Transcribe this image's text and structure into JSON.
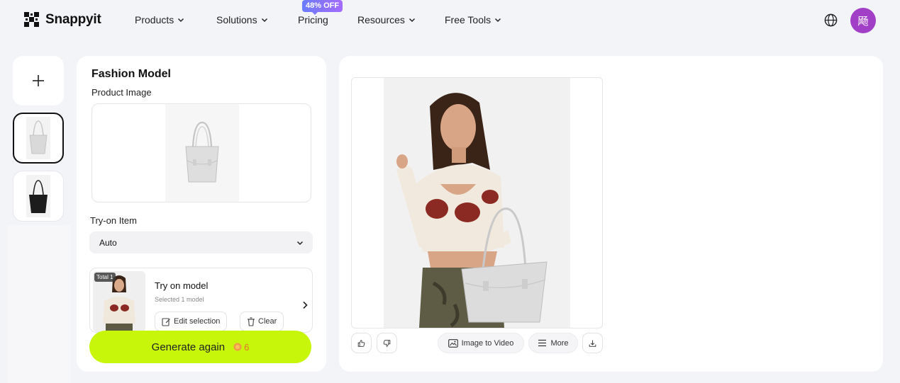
{
  "header": {
    "brand": "Snappyit",
    "nav": [
      {
        "label": "Products",
        "has_dropdown": true
      },
      {
        "label": "Solutions",
        "has_dropdown": true
      },
      {
        "label": "Pricing",
        "has_dropdown": false
      },
      {
        "label": "Resources",
        "has_dropdown": true
      },
      {
        "label": "Free Tools",
        "has_dropdown": true
      }
    ],
    "promo_badge": "48% OFF",
    "globe_icon": "globe-icon",
    "avatar_initial": "飏",
    "avatar_color": "#a13fc7"
  },
  "history": {
    "new_icon": "plus-icon",
    "items": [
      {
        "kind": "white-handbag",
        "selected": true
      },
      {
        "kind": "black-handbag",
        "selected": false
      }
    ]
  },
  "settings": {
    "title": "Fashion Model",
    "product_image_label": "Product Image",
    "tryon_label": "Try-on Item",
    "tryon_value": "Auto",
    "model_card": {
      "badge": "Total 1",
      "title": "Try on model",
      "subtitle": "Selected 1 model",
      "edit_label": "Edit selection",
      "clear_label": "Clear"
    },
    "generate_label": "Generate again",
    "credits": "6",
    "accent_color": "#c7f60a"
  },
  "result": {
    "toolbar": {
      "like_icon": "thumbs-up-icon",
      "dislike_icon": "thumbs-down-icon",
      "image_to_video_label": "Image to Video",
      "more_label": "More",
      "download_icon": "download-icon"
    }
  }
}
